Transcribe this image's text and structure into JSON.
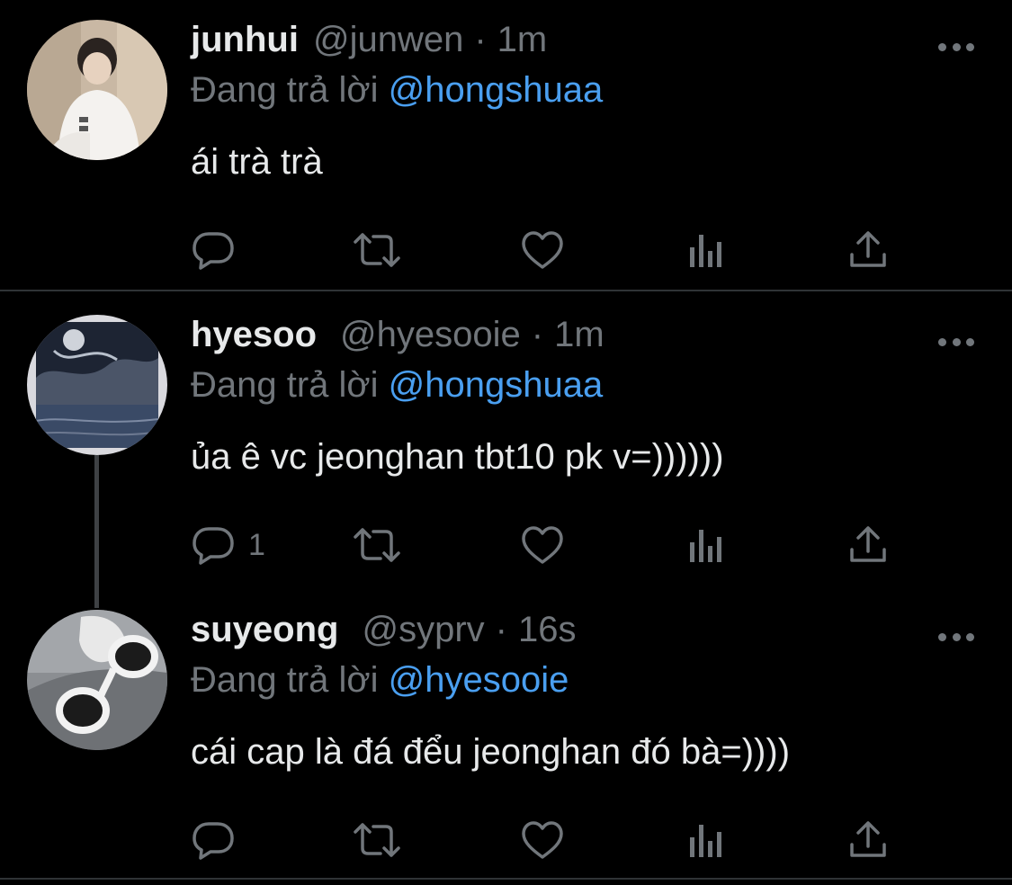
{
  "colors": {
    "background": "#000000",
    "text_primary": "#e7e9ea",
    "text_secondary": "#71767b",
    "link": "#4a9ff0",
    "divider": "#2f3336"
  },
  "tweets": [
    {
      "name": "junhui",
      "handle": "@junwen",
      "separator": "·",
      "time": "1m",
      "reply_prefix": "Đang trả lời",
      "reply_to": "@hongshuaa",
      "text": "ái trà trà",
      "reply_count": "",
      "avatar_icon": "avatar-photo-person-white-hoodie"
    },
    {
      "name": "hyesoo",
      "handle": "@hyesooie",
      "separator": "·",
      "time": "1m",
      "reply_prefix": "Đang trả lời",
      "reply_to": "@hongshuaa",
      "text": "ủa ê vc jeonghan tbt10 pk v=))))))",
      "reply_count": "1",
      "avatar_icon": "avatar-photo-moon-painting"
    },
    {
      "name": "suyeong",
      "handle": "@syprv",
      "separator": "·",
      "time": "16s",
      "reply_prefix": "Đang trả lời",
      "reply_to": "@hyesooie",
      "text": "cái cap là đá đểu jeonghan đó bà=))))",
      "reply_count": "",
      "avatar_icon": "avatar-photo-sunglasses"
    }
  ],
  "icons": {
    "reply": "reply-icon",
    "retweet": "retweet-icon",
    "like": "heart-icon",
    "views": "views-icon",
    "share": "share-icon",
    "more": "more-icon"
  }
}
